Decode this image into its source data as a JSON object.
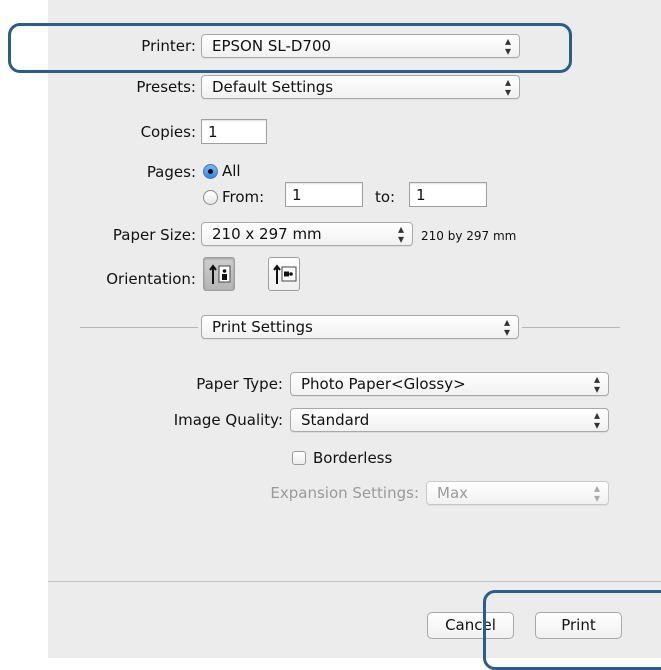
{
  "printer": {
    "label": "Printer:",
    "value": "EPSON SL-D700"
  },
  "presets": {
    "label": "Presets:",
    "value": "Default Settings"
  },
  "copies": {
    "label": "Copies:",
    "value": "1"
  },
  "pages": {
    "label": "Pages:",
    "all_label": "All",
    "from_label": "From:",
    "from_value": "1",
    "to_label": "to:",
    "to_value": "1",
    "selected": "All"
  },
  "paper_size": {
    "label": "Paper Size:",
    "value": "210 x 297 mm",
    "note": "210 by 297 mm"
  },
  "orientation": {
    "label": "Orientation:",
    "selected": "portrait"
  },
  "section": {
    "value": "Print Settings"
  },
  "paper_type": {
    "label": "Paper Type:",
    "value": "Photo Paper<Glossy>"
  },
  "image_quality": {
    "label": "Image Quality:",
    "value": "Standard"
  },
  "borderless": {
    "label": "Borderless",
    "checked": false
  },
  "expansion": {
    "label": "Expansion Settings:",
    "value": "Max"
  },
  "buttons": {
    "cancel": "Cancel",
    "print": "Print"
  },
  "colors": {
    "highlight": "#2a5d88",
    "accent": "#3b82d9",
    "panel": "#ececec"
  }
}
